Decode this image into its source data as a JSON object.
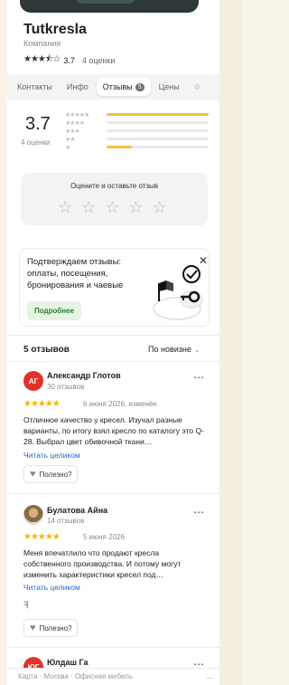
{
  "header": {
    "title": "Tutkresla",
    "subtitle": "Компания",
    "stars": "★★★⯪☆",
    "rating": "3.7",
    "reviews_count": "4 оценки"
  },
  "tabs": [
    {
      "label": "Контакты"
    },
    {
      "label": "Инфо"
    },
    {
      "label": "Отзывы",
      "badge": "5",
      "active": true
    },
    {
      "label": "Цены"
    },
    {
      "label": "Ф"
    }
  ],
  "summary": {
    "rating": "3.7",
    "count": "4 оценки",
    "distribution": [
      {
        "stars": "★★★★★",
        "fraction": 1.0
      },
      {
        "stars": "★★★★",
        "fraction": 0.0
      },
      {
        "stars": "★★★",
        "fraction": 0.0
      },
      {
        "stars": "★★",
        "fraction": 0.0
      },
      {
        "stars": "★",
        "fraction": 0.25
      }
    ]
  },
  "rate_prompt": {
    "label": "Оцените и оставьте отзыв",
    "stars": [
      "☆",
      "☆",
      "☆",
      "☆",
      "☆"
    ]
  },
  "promo": {
    "text": "Подтверждаем отзывы: оплаты, посещения, бронирования и чаевые",
    "button": "Подробнее",
    "close": "✕"
  },
  "reviews_header": {
    "count": "5 отзывов",
    "sort": "По новизне",
    "sort_icon": "chevron-down-icon"
  },
  "reviews": [
    {
      "initials": "АГ",
      "author": "Александр Глотов",
      "author_sub": "30 отзывов",
      "stars": "★★★★★",
      "date": "6 июня 2026, изменён",
      "text": "Отличное качество у кресел. Изучал разные варианты, по итогу взял кресло по каталогу это Q-28. Выбрал цвет обивочной ткани…",
      "read_more": "Читать целиком",
      "useful": "Полезно?"
    },
    {
      "initials": "",
      "author": "Булатова Айна",
      "author_sub": "14 отзывов",
      "stars": "★★★★★",
      "date": "5 июня 2026",
      "text": "Меня впечатлило что продают кресла собственного производства. И потому могут изменить характеристики кресел под…",
      "read_more": "Читать целиком",
      "useful": "Полезно?",
      "response_icon": "ꟻ"
    },
    {
      "initials": "ЮГ",
      "author": "Юлдаш Га"
    }
  ],
  "footer": {
    "crumbs": "Карта · Москва · Офисная мебель",
    "dots": "..."
  },
  "colors": {
    "accent_yellow": "#f6c33a",
    "star_yellow": "#f6b400",
    "link_blue": "#1a6bd6",
    "promo_green": "#2e7d32",
    "avatar_red": "#e0322b"
  }
}
